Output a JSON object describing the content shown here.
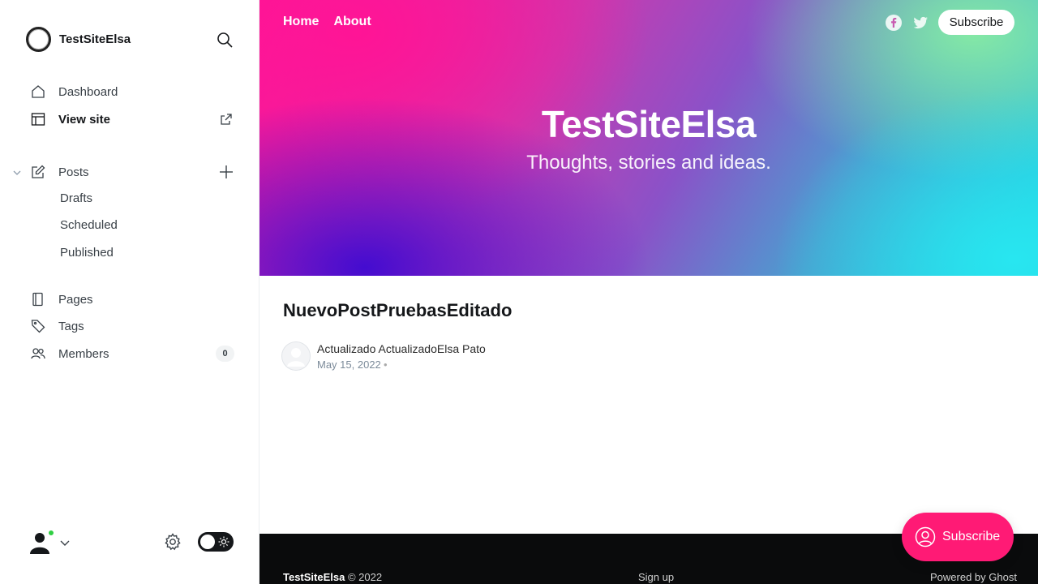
{
  "sidebar": {
    "site_name": "TestSiteElsa",
    "nav": {
      "dashboard": "Dashboard",
      "view_site": "View site",
      "posts": "Posts",
      "drafts": "Drafts",
      "scheduled": "Scheduled",
      "published": "Published",
      "pages": "Pages",
      "tags": "Tags",
      "members": "Members",
      "members_count": "0"
    }
  },
  "preview": {
    "nav": {
      "home": "Home",
      "about": "About"
    },
    "subscribe_label": "Subscribe",
    "site_title": "TestSiteElsa",
    "site_description": "Thoughts, stories and ideas.",
    "post": {
      "title": "NuevoPostPruebasEditado",
      "author": "Actualizado ActualizadoElsa Pato",
      "date": "May 15, 2022",
      "separator": "•"
    },
    "footer": {
      "site_name": "TestSiteElsa",
      "copyright": "© 2022",
      "signup": "Sign up",
      "powered": "Powered by Ghost"
    },
    "portal_button_label": "Subscribe"
  },
  "colors": {
    "accent": "#ff1a75",
    "online_status": "#30cf43",
    "footer_bg": "#0a0b0c"
  }
}
